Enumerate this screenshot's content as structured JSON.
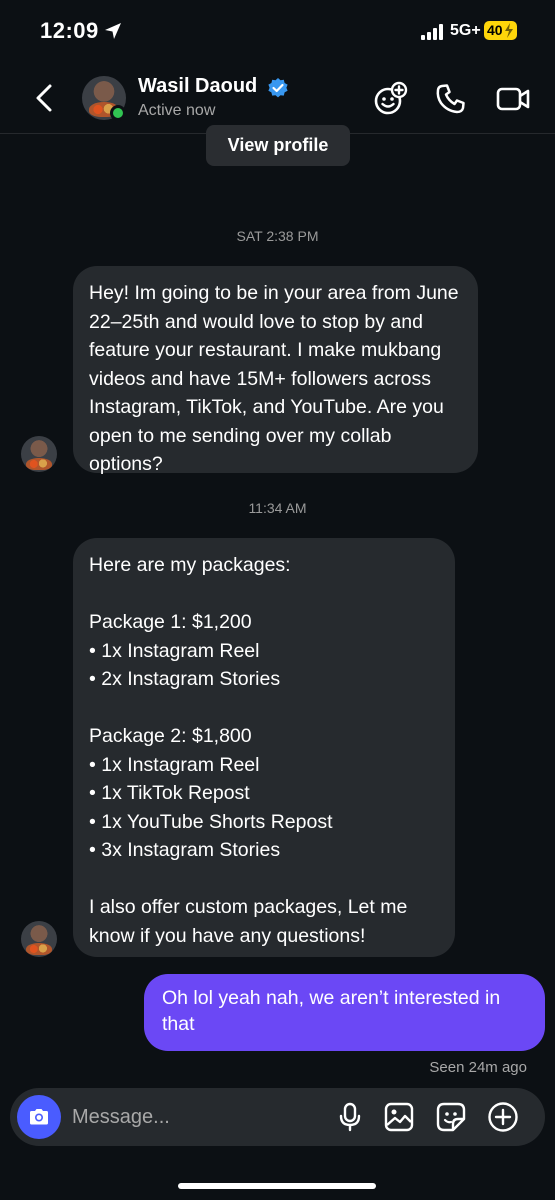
{
  "status_bar": {
    "time": "12:09",
    "network": "5G+",
    "battery": "40"
  },
  "header": {
    "name": "Wasil Daoud",
    "status": "Active now",
    "icons": [
      "back-icon",
      "verified-icon",
      "group-add-icon",
      "phone-icon",
      "video-camera-icon"
    ]
  },
  "thread": {
    "view_profile": "View profile",
    "timestamp_1": "SAT 2:38 PM",
    "message_1": "Hey! Im going to be in your area from June 22–25th and would love to stop by and feature your restaurant. I make mukbang videos and have 15M+ followers across Instagram, TikTok, and YouTube. Are you open to me sending over my collab options?",
    "timestamp_2": "11:34 AM",
    "message_2": "Here are my packages:\n\nPackage 1: $1,200\n• 1x Instagram Reel\n• 2x Instagram Stories\n\nPackage 2: $1,800\n• 1x Instagram Reel\n• 1x TikTok Repost\n• 1x YouTube Shorts Repost\n• 3x Instagram Stories\n\nI also offer custom packages, Let me know if you have any questions!",
    "reply": "Oh lol yeah nah, we aren’t interested in that",
    "seen": "Seen 24m ago"
  },
  "composer": {
    "placeholder": "Message...",
    "icons": [
      "camera-icon",
      "microphone-icon",
      "gallery-icon",
      "sticker-icon",
      "plus-icon"
    ]
  },
  "colors": {
    "background": "#0c1014",
    "incoming_bubble": "#262a2e",
    "outgoing_bubble": "#6b48f5",
    "camera_button": "#4a5cff",
    "active_dot": "#31c452",
    "battery": "#ffd60a"
  }
}
